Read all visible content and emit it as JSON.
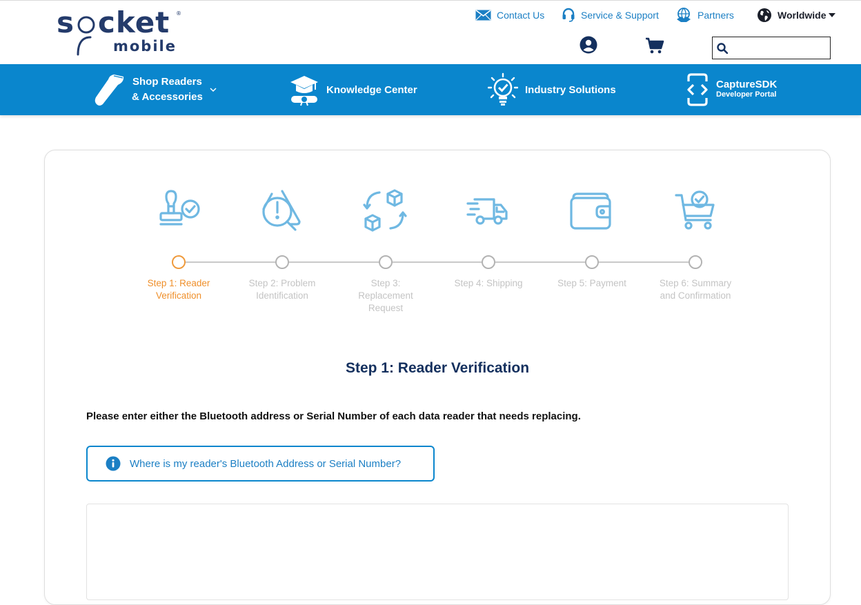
{
  "header": {
    "logo_word": "s",
    "logo_word2": "cket",
    "logo_sub": "mobile",
    "logo_reg": "®",
    "utility": {
      "contact": "Contact Us",
      "service": "Service & Support",
      "partners": "Partners",
      "region": "Worldwide"
    },
    "search": {
      "placeholder": "",
      "value": ""
    }
  },
  "nav": {
    "shop_line1": "Shop Readers",
    "shop_line2": "& Accessories",
    "knowledge": "Knowledge Center",
    "industry": "Industry Solutions",
    "sdk_line1": "CaptureSDK",
    "sdk_line2": "Developer Portal"
  },
  "steps": [
    {
      "label": "Step 1: Reader Verification",
      "icon": "stamp-check-icon",
      "active": true
    },
    {
      "label": "Step 2: Problem Identification",
      "icon": "warning-magnifier-icon",
      "active": false
    },
    {
      "label": "Step 3: Replacement Request",
      "icon": "box-exchange-icon",
      "active": false
    },
    {
      "label": "Step 4: Shipping",
      "icon": "delivery-truck-icon",
      "active": false
    },
    {
      "label": "Step 5: Payment",
      "icon": "wallet-icon",
      "active": false
    },
    {
      "label": "Step 6: Summary and Confirmation",
      "icon": "cart-check-icon",
      "active": false
    }
  ],
  "main": {
    "title": "Step 1: Reader Verification",
    "instruction": "Please enter either the Bluetooth address or Serial Number of each data reader that needs replacing.",
    "help_button": "Where is my reader's Bluetooth Address or Serial Number?"
  },
  "colors": {
    "brand_navy": "#243b6b",
    "nav_blue": "#0a86cd",
    "link_blue": "#1b7fc4",
    "active_orange": "#ef8f2a",
    "step_icon_blue": "#6fb8e2",
    "inactive_gray": "#c4c4c4"
  }
}
